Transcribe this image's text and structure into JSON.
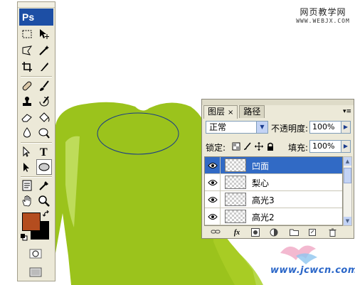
{
  "watermark": {
    "top_line1": "网页教学网",
    "top_line2": "WWW.WEBJX.COM",
    "bottom": "www.jcwcn.com"
  },
  "toolbox": {
    "logo": "Ps",
    "foreground_color": "#b44d1f",
    "background_color": "#000000",
    "tools": [
      "marquee-tool",
      "move-tool",
      "lasso-tool",
      "magic-wand-tool",
      "crop-tool",
      "slice-tool",
      "healing-brush-tool",
      "brush-tool",
      "clone-stamp-tool",
      "history-brush-tool",
      "eraser-tool",
      "paint-bucket-tool",
      "blur-tool",
      "dodge-tool",
      "path-selection-tool",
      "type-tool",
      "direct-selection-tool",
      "ellipse-tool",
      "notes-tool",
      "eyedropper-tool",
      "hand-tool",
      "zoom-tool"
    ]
  },
  "canvas": {
    "fill_color": "#9ac21e",
    "selection": "ellipse"
  },
  "layers_panel": {
    "tabs": [
      {
        "label": "图层",
        "close": "×"
      },
      {
        "label": "路径"
      }
    ],
    "menu_icon": "▾≡",
    "blend_mode": "正常",
    "opacity_label": "不透明度:",
    "opacity_value": "100%",
    "lock_label": "锁定:",
    "fill_label": "填充:",
    "fill_value": "100%",
    "layers": [
      {
        "name": "凹面",
        "selected": true
      },
      {
        "name": "梨心",
        "selected": false
      },
      {
        "name": "高光3",
        "selected": false
      },
      {
        "name": "高光2",
        "selected": false
      }
    ]
  }
}
